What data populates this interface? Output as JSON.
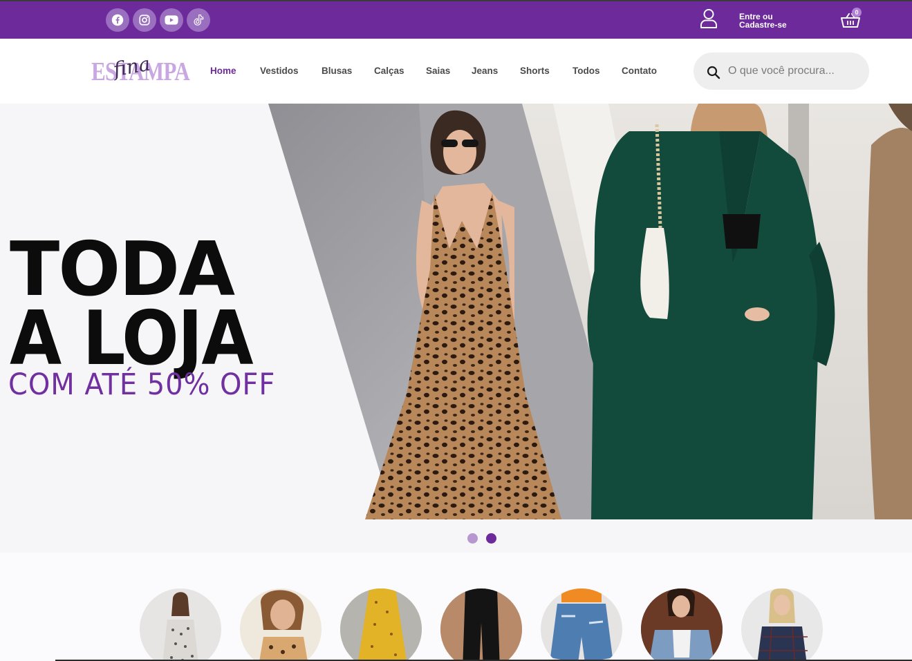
{
  "topbar": {
    "socials": [
      {
        "icon": "facebook-icon",
        "label": "Facebook"
      },
      {
        "icon": "instagram-icon",
        "label": "Instagram"
      },
      {
        "icon": "youtube-icon",
        "label": "YouTube"
      },
      {
        "icon": "tiktok-icon",
        "label": "TikTok"
      }
    ],
    "login_line1": "Entre ou",
    "login_line2": "Cadastre-se",
    "cart_count": "0"
  },
  "header": {
    "logo_main": "ESTAMPA",
    "logo_script": "fina",
    "nav": [
      "Home",
      "Vestidos",
      "Blusas",
      "Calças",
      "Saias",
      "Jeans",
      "Shorts",
      "Todos",
      "Contato"
    ],
    "active_nav": "Home",
    "search_placeholder": "O que você procura..."
  },
  "hero": {
    "line1": "TODA",
    "line2": "A LOJA",
    "line3": "COM ATÉ 50% OFF",
    "slides": 2,
    "active_slide": 2
  },
  "categories": {
    "items": [
      "dress-polka",
      "blouse-leopard",
      "skirt-yellow",
      "pants-black",
      "shorts-denim",
      "jacket-denim",
      "blazer-plaid"
    ]
  },
  "colors": {
    "brand_purple": "#6c2a9a",
    "accent_lilac": "#9a6fbf",
    "headline_black": "#0c0c0c",
    "offer_purple": "#7030a0"
  }
}
